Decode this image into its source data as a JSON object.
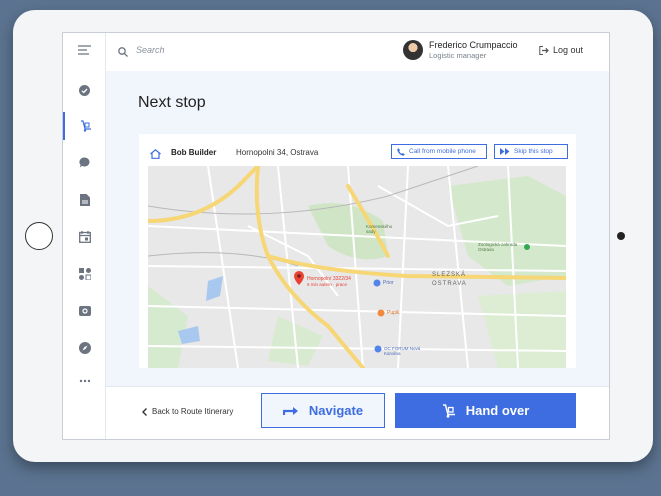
{
  "header": {
    "search_placeholder": "Search",
    "user_name": "Frederico Crumpaccio",
    "user_role": "Logistic manager",
    "logout_label": "Log out"
  },
  "sidebar": {
    "items": [
      {
        "icon": "menu-icon"
      },
      {
        "icon": "check-circle-icon"
      },
      {
        "icon": "hand-truck-icon",
        "active": true
      },
      {
        "icon": "chat-icon"
      },
      {
        "icon": "document-icon"
      },
      {
        "icon": "calendar-icon"
      },
      {
        "icon": "apps-icon"
      },
      {
        "icon": "camera-icon"
      },
      {
        "icon": "compass-icon"
      },
      {
        "icon": "more-icon"
      }
    ]
  },
  "main": {
    "title": "Next stop",
    "recipient_name": "Bob Builder",
    "recipient_address": "Hornopolni 34, Ostrava",
    "call_button": "Call from mobile phone",
    "skip_button": "Skip this stop"
  },
  "map": {
    "marker_title": "Hornopolní 3322/34",
    "marker_subtitle": "6 min autem · prace",
    "labels": {
      "komenskeho": "Komenského sady",
      "prior": "Prior",
      "slezska": "SLEZSKÁ",
      "ostrava": "OSTRAVA",
      "zoo": "Zoologická zahrada Ostrava",
      "forum": "OC FORUM Nová Karolina",
      "pupik": "Pupik"
    },
    "accent_color": "#e94235"
  },
  "footer": {
    "back_label": "Back to Route Itinerary",
    "navigate_label": "Navigate",
    "handover_label": "Hand over"
  },
  "colors": {
    "accent": "#3d6de0",
    "background": "#5b7390",
    "content_bg": "#f1f5fc"
  }
}
